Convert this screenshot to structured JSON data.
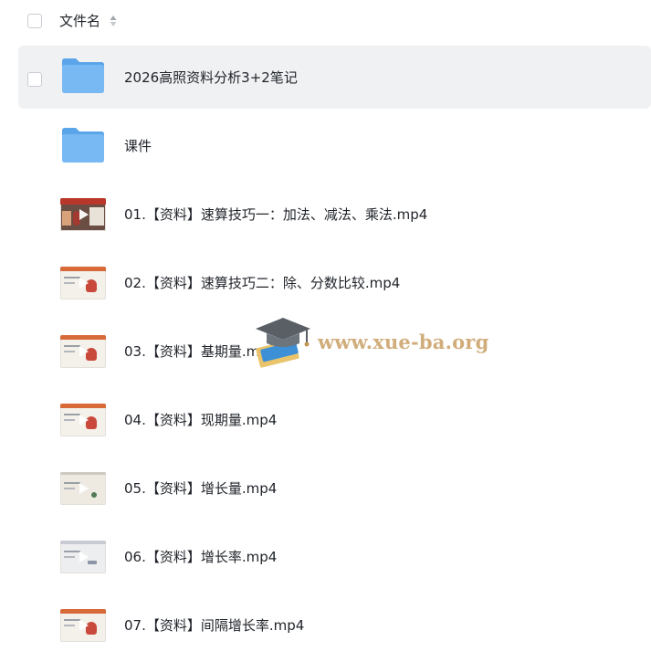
{
  "header": {
    "title": "文件名",
    "sort_icon": "sort-caret-icon"
  },
  "files": [
    {
      "type": "folder",
      "name": "2026高照资料分析3+2笔记",
      "selected": true
    },
    {
      "type": "folder",
      "name": "课件",
      "selected": false
    },
    {
      "type": "video",
      "name": "01.【资料】速算技巧一：加法、减法、乘法.mp4",
      "thumb": "photo"
    },
    {
      "type": "video",
      "name": "02.【资料】速算技巧二：除、分数比较.mp4",
      "thumb": "slide"
    },
    {
      "type": "video",
      "name": "03.【资料】基期量.mp4",
      "thumb": "slide"
    },
    {
      "type": "video",
      "name": "04.【资料】现期量.mp4",
      "thumb": "slide"
    },
    {
      "type": "video",
      "name": "05.【资料】增长量.mp4",
      "thumb": "sketch"
    },
    {
      "type": "video",
      "name": "06.【资料】增长率.mp4",
      "thumb": "light"
    },
    {
      "type": "video",
      "name": "07.【资料】间隔增长率.mp4",
      "thumb": "slide"
    }
  ],
  "watermark": {
    "text": "www.xue-ba.org",
    "icon": "graduation-cap-icon"
  },
  "colors": {
    "folder": "#72b5f2",
    "folder_dark": "#5aa4ea",
    "selected_row": "#f0f1f3",
    "text": "#1f2329",
    "watermark": "#c49656"
  }
}
